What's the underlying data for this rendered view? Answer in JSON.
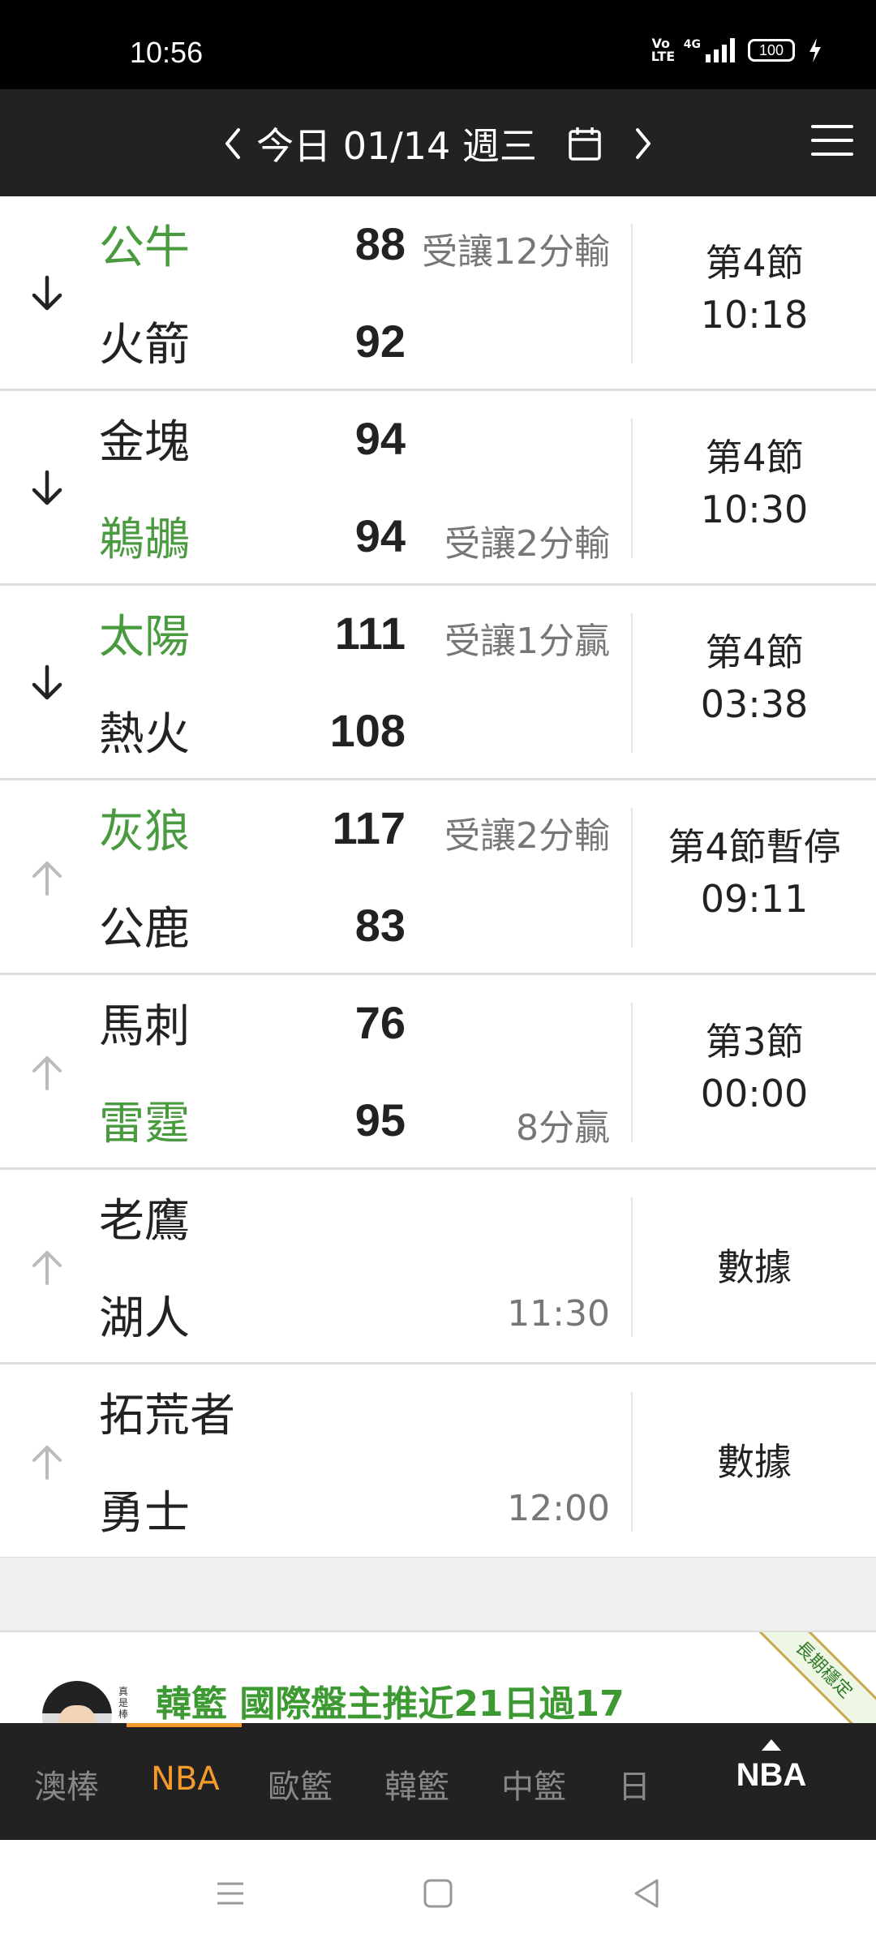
{
  "status_bar": {
    "time": "10:56",
    "battery": "100",
    "network": "4G",
    "volte": "Vo LTE"
  },
  "header": {
    "date_label": "今日 01/14 週三",
    "icons": [
      "chevron-left-icon",
      "calendar-icon",
      "chevron-right-icon",
      "menu-icon"
    ]
  },
  "games": [
    {
      "direction": "down",
      "team1": "公牛",
      "team1_fav": true,
      "score1": "88",
      "note1": "受讓12分輸",
      "team2": "火箭",
      "team2_fav": false,
      "score2": "92",
      "note2": "",
      "status_line1": "第4節",
      "status_line2": "10:18"
    },
    {
      "direction": "down",
      "team1": "金塊",
      "team1_fav": false,
      "score1": "94",
      "note1": "",
      "team2": "鵜鶘",
      "team2_fav": true,
      "score2": "94",
      "note2": "受讓2分輸",
      "status_line1": "第4節",
      "status_line2": "10:30"
    },
    {
      "direction": "down",
      "team1": "太陽",
      "team1_fav": true,
      "score1": "111",
      "note1": "受讓1分贏",
      "team2": "熱火",
      "team2_fav": false,
      "score2": "108",
      "note2": "",
      "status_line1": "第4節",
      "status_line2": "03:38"
    },
    {
      "direction": "up",
      "team1": "灰狼",
      "team1_fav": true,
      "score1": "117",
      "note1": "受讓2分輸",
      "team2": "公鹿",
      "team2_fav": false,
      "score2": "83",
      "note2": "",
      "status_line1": "第4節暫停",
      "status_line2": "09:11"
    },
    {
      "direction": "up",
      "team1": "馬刺",
      "team1_fav": false,
      "score1": "76",
      "note1": "",
      "team2": "雷霆",
      "team2_fav": true,
      "score2": "95",
      "note2": "8分贏",
      "status_line1": "第3節",
      "status_line2": "00:00"
    },
    {
      "direction": "up",
      "team1": "老鷹",
      "team1_fav": false,
      "score1": "",
      "note1": "",
      "team2": "湖人",
      "team2_fav": false,
      "score2": "",
      "note2": "11:30",
      "status_line1": "數據",
      "status_line2": ""
    },
    {
      "direction": "up",
      "team1": "拓荒者",
      "team1_fav": false,
      "score1": "",
      "note1": "",
      "team2": "勇士",
      "team2_fav": false,
      "score2": "",
      "note2": "12:00",
      "status_line1": "數據",
      "status_line2": ""
    }
  ],
  "ad": {
    "text": "韓籃 國際盤主推近21日過17",
    "side_text": "真是棒",
    "ribbon": "長期穩定"
  },
  "tabs": [
    {
      "label": "澳棒",
      "active": false
    },
    {
      "label": "NBA",
      "active": true
    },
    {
      "label": "歐籃",
      "active": false
    },
    {
      "label": "韓籃",
      "active": false
    },
    {
      "label": "中籃",
      "active": false
    },
    {
      "label": "日",
      "active": false
    }
  ],
  "right_tab": {
    "label": "NBA"
  },
  "colors": {
    "favorite_team": "#4a9a3f",
    "active_tab": "#f39a2b",
    "header_bg": "#222222",
    "ad_text": "#3d9a32"
  }
}
